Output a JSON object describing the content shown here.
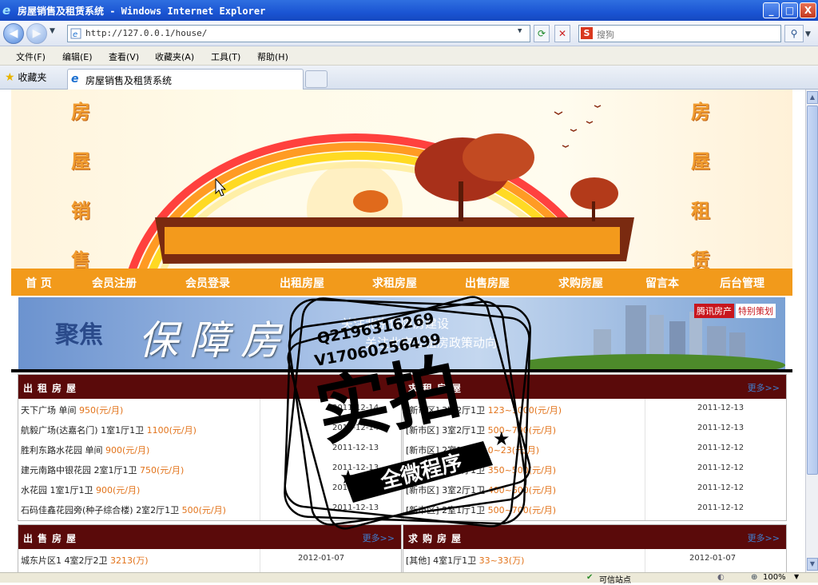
{
  "window": {
    "title": "房屋销售及租赁系统 - Windows Internet Explorer",
    "minimize": "_",
    "maximize": "□",
    "close": "X"
  },
  "browser": {
    "address": "http://127.0.0.1/house/",
    "search_placeholder": "搜狗",
    "menus": [
      "文件(F)",
      "编辑(E)",
      "查看(V)",
      "收藏夹(A)",
      "工具(T)",
      "帮助(H)"
    ],
    "favorites_label": "收藏夹",
    "tab_title": "房屋销售及租赁系统",
    "status_zone": "可信站点",
    "zoom": "100%"
  },
  "banner": {
    "left_chars": [
      "房",
      "屋",
      "销",
      "售"
    ],
    "right_chars": [
      "房",
      "屋",
      "租",
      "赁"
    ]
  },
  "nav": [
    "首 页",
    "会员注册",
    "会员登录",
    "出租房屋",
    "求租房屋",
    "出售房屋",
    "求购房屋",
    "留言本",
    "后台管理"
  ],
  "focus_banner": {
    "focus": "聚焦",
    "title": "保障房",
    "sub1": "关注北京保障房建设",
    "sub2": "关注北京公租房政策动向",
    "tag1": "腾讯房产",
    "tag2": "特别策划"
  },
  "watermark": {
    "line1": "Q2196316269",
    "line2": "V17060256499",
    "big": "实拍",
    "ribbon": "全微程序"
  },
  "panels": {
    "rent": {
      "title": "出租房屋",
      "more": "更多>>",
      "rows": [
        {
          "text": "天下广场 单间 ",
          "price": "950(元/月)",
          "date": "2011-12-14"
        },
        {
          "text": "航毅广场(达嘉名门) 1室1厅1卫 ",
          "price": "1100(元/月)",
          "date": "2011-12-14"
        },
        {
          "text": "胜利东路水花园 单间 ",
          "price": "900(元/月)",
          "date": "2011-12-13"
        },
        {
          "text": "建元南路中银花园 2室1厅1卫 ",
          "price": "750(元/月)",
          "date": "2011-12-13"
        },
        {
          "text": "水花园 1室1厅1卫 ",
          "price": "900(元/月)",
          "date": "2011-12-13"
        },
        {
          "text": "石码佳鑫花园旁(种子综合楼) 2室2厅1卫 ",
          "price": "500(元/月)",
          "date": "2011-12-13"
        }
      ]
    },
    "want_rent": {
      "title": "求租房屋",
      "more": "更多>>",
      "rows": [
        {
          "text": "[新市区] 3室2厅1卫 ",
          "price": "123~1000(元/月)",
          "date": "2011-12-13"
        },
        {
          "text": "[新市区] 3室2厅1卫 ",
          "price": "500~700(元/月)",
          "date": "2011-12-13"
        },
        {
          "text": "[新市区] 2室1厅1卫 ",
          "price": "0~23(元/月)",
          "date": "2011-12-12"
        },
        {
          "text": "[新市区] 2室1厅1卫 ",
          "price": "350~500(元/月)",
          "date": "2011-12-12"
        },
        {
          "text": "[新市区] 3室2厅1卫 ",
          "price": "400~600(元/月)",
          "date": "2011-12-12"
        },
        {
          "text": "[新市区] 2室1厅1卫 ",
          "price": "500~700(元/月)",
          "date": "2011-12-12"
        }
      ]
    },
    "sale": {
      "title": "出售房屋",
      "more": "更多>>",
      "rows": [
        {
          "text": "城东片区1 4室2厅2卫 ",
          "price": "3213(万)",
          "date": "2012-01-07"
        }
      ]
    },
    "want_buy": {
      "title": "求购房屋",
      "more": "更多>>",
      "rows": [
        {
          "text": "[其他] 4室1厅1卫 ",
          "price": "33~33(万)",
          "date": "2012-01-07"
        }
      ]
    }
  }
}
